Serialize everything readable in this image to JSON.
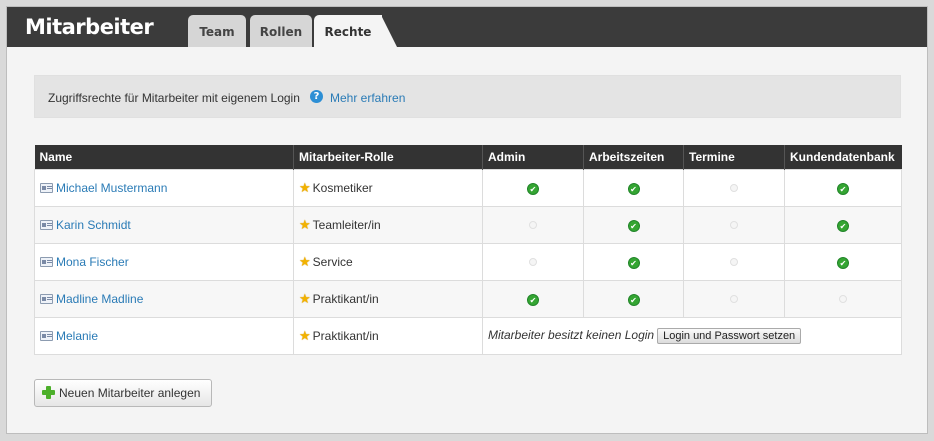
{
  "app": {
    "title": "Mitarbeiter"
  },
  "tabs": [
    {
      "label": "Team",
      "active": false
    },
    {
      "label": "Rollen",
      "active": false
    },
    {
      "label": "Rechte",
      "active": true
    }
  ],
  "info": {
    "text": "Zugriffsrechte für Mitarbeiter mit eigenem Login",
    "help_icon": "?",
    "link": "Mehr erfahren"
  },
  "table": {
    "headers": [
      "Name",
      "Mitarbeiter-Rolle",
      "Admin",
      "Arbeitszeiten",
      "Termine",
      "Kundendatenbank"
    ],
    "rows": [
      {
        "name": "Michael Mustermann",
        "role": "Kosmetiker",
        "admin": true,
        "arbeitszeiten": true,
        "termine": false,
        "kundendatenbank": true
      },
      {
        "name": "Karin Schmidt",
        "role": "Teamleiter/in",
        "admin": false,
        "arbeitszeiten": true,
        "termine": false,
        "kundendatenbank": true
      },
      {
        "name": "Mona Fischer",
        "role": "Service",
        "admin": false,
        "arbeitszeiten": true,
        "termine": false,
        "kundendatenbank": true
      },
      {
        "name": "Madline Madline",
        "role": "Praktikant/in",
        "admin": true,
        "arbeitszeiten": true,
        "termine": false,
        "kundendatenbank": false
      },
      {
        "name": "Melanie",
        "role": "Praktikant/in",
        "no_login_text": "Mitarbeiter besitzt keinen Login",
        "no_login_button": "Login und Passwort setzen"
      }
    ]
  },
  "add_button": {
    "label": "Neuen Mitarbeiter anlegen"
  },
  "icons": {
    "check": "✔",
    "star": "★"
  },
  "colors": {
    "header_bg": "#3b3b3b",
    "link": "#2a7bb6",
    "check": "#34a532",
    "star": "#f2b200"
  }
}
